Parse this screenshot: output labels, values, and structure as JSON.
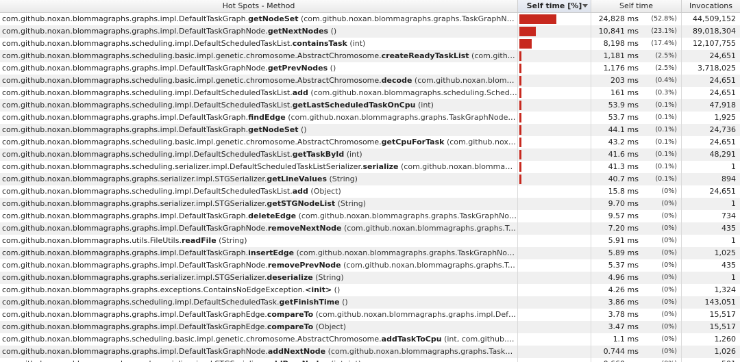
{
  "header": {
    "method": "Hot Spots - Method",
    "self_time_pct": "Self time [%]",
    "self_time": "Self time",
    "invocations": "Invocations"
  },
  "colors": {
    "bar": "#c7281e",
    "row_alt": "#f0f0f0"
  },
  "rows": [
    {
      "prefix": "com.github.noxan.blommagraphs.graphs.impl.DefaultTaskGraph.",
      "name": "getNodeSet",
      "args": " (com.github.noxan.blommagraphs.graphs.TaskGraphNode)",
      "time": "24,828 ms",
      "pct": "(52.8%)",
      "pct_value": 52.8,
      "invocations": "44,509,152"
    },
    {
      "prefix": "com.github.noxan.blommagraphs.graphs.impl.DefaultTaskGraphNode.",
      "name": "getNextNodes",
      "args": " ()",
      "time": "10,841 ms",
      "pct": "(23.1%)",
      "pct_value": 23.1,
      "invocations": "89,018,304"
    },
    {
      "prefix": "com.github.noxan.blommagraphs.scheduling.impl.DefaultScheduledTaskList.",
      "name": "containsTask",
      "args": " (int)",
      "time": "8,198 ms",
      "pct": "(17.4%)",
      "pct_value": 17.4,
      "invocations": "12,107,755"
    },
    {
      "prefix": "com.github.noxan.blommagraphs.scheduling.basic.impl.genetic.chromosome.AbstractChromosome.",
      "name": "createReadyTaskList",
      "args": " (com.github.noxan.blommagraphs.graphs.TaskGraph)",
      "time": "1,181 ms",
      "pct": "(2.5%)",
      "pct_value": 2.5,
      "invocations": "24,651"
    },
    {
      "prefix": "com.github.noxan.blommagraphs.graphs.impl.DefaultTaskGraphNode.",
      "name": "getPrevNodes",
      "args": " ()",
      "time": "1,176 ms",
      "pct": "(2.5%)",
      "pct_value": 2.5,
      "invocations": "3,718,025"
    },
    {
      "prefix": "com.github.noxan.blommagraphs.scheduling.basic.impl.genetic.chromosome.AbstractChromosome.",
      "name": "decode",
      "args": " (com.github.noxan.blommagraphs.graphs.TaskGraph)",
      "time": "203 ms",
      "pct": "(0.4%)",
      "pct_value": 0.4,
      "invocations": "24,651"
    },
    {
      "prefix": "com.github.noxan.blommagraphs.scheduling.impl.DefaultScheduledTaskList.",
      "name": "add",
      "args": " (com.github.noxan.blommagraphs.scheduling.ScheduledTask)",
      "time": "161 ms",
      "pct": "(0.3%)",
      "pct_value": 0.3,
      "invocations": "24,651"
    },
    {
      "prefix": "com.github.noxan.blommagraphs.scheduling.impl.DefaultScheduledTaskList.",
      "name": "getLastScheduledTaskOnCpu",
      "args": " (int)",
      "time": "53.9 ms",
      "pct": "(0.1%)",
      "pct_value": 0.1,
      "invocations": "47,918"
    },
    {
      "prefix": "com.github.noxan.blommagraphs.graphs.impl.DefaultTaskGraph.",
      "name": "findEdge",
      "args": " (com.github.noxan.blommagraphs.graphs.TaskGraphNode, com.github.noxan.blommagraphs.graphs.TaskGraphNode)",
      "time": "53.7 ms",
      "pct": "(0.1%)",
      "pct_value": 0.1,
      "invocations": "1,925"
    },
    {
      "prefix": "com.github.noxan.blommagraphs.graphs.impl.DefaultTaskGraph.",
      "name": "getNodeSet",
      "args": " ()",
      "time": "44.1 ms",
      "pct": "(0.1%)",
      "pct_value": 0.1,
      "invocations": "24,736"
    },
    {
      "prefix": "com.github.noxan.blommagraphs.scheduling.basic.impl.genetic.chromosome.AbstractChromosome.",
      "name": "getCpuForTask",
      "args": " (com.github.noxan.blommagraphs.graphs.TaskGraphNode)",
      "time": "43.2 ms",
      "pct": "(0.1%)",
      "pct_value": 0.1,
      "invocations": "24,651"
    },
    {
      "prefix": "com.github.noxan.blommagraphs.scheduling.impl.DefaultScheduledTaskList.",
      "name": "getTaskById",
      "args": " (int)",
      "time": "41.6 ms",
      "pct": "(0.1%)",
      "pct_value": 0.1,
      "invocations": "48,291"
    },
    {
      "prefix": "com.github.noxan.blommagraphs.scheduling.serializer.impl.DefaultScheduledTaskListSerializer.",
      "name": "serialize",
      "args": " (com.github.noxan.blommagraphs.scheduling.ScheduledTaskList)",
      "time": "41.3 ms",
      "pct": "(0.1%)",
      "pct_value": 0.1,
      "invocations": "1"
    },
    {
      "prefix": "com.github.noxan.blommagraphs.graphs.serializer.impl.STGSerializer.",
      "name": "getLineValues",
      "args": " (String)",
      "time": "40.7 ms",
      "pct": "(0.1%)",
      "pct_value": 0.1,
      "invocations": "894"
    },
    {
      "prefix": "com.github.noxan.blommagraphs.scheduling.impl.DefaultScheduledTaskList.",
      "name": "add",
      "args": " (Object)",
      "time": "15.8 ms",
      "pct": "(0%)",
      "pct_value": 0,
      "invocations": "24,651"
    },
    {
      "prefix": "com.github.noxan.blommagraphs.graphs.serializer.impl.STGSerializer.",
      "name": "getSTGNodeList",
      "args": " (String)",
      "time": "9.70 ms",
      "pct": "(0%)",
      "pct_value": 0,
      "invocations": "1"
    },
    {
      "prefix": "com.github.noxan.blommagraphs.graphs.impl.DefaultTaskGraph.",
      "name": "deleteEdge",
      "args": " (com.github.noxan.blommagraphs.graphs.TaskGraphNode, com.github.noxan.blommagraphs.graphs.TaskGraphNode)",
      "time": "9.57 ms",
      "pct": "(0%)",
      "pct_value": 0,
      "invocations": "734"
    },
    {
      "prefix": "com.github.noxan.blommagraphs.graphs.impl.DefaultTaskGraphNode.",
      "name": "removeNextNode",
      "args": " (com.github.noxan.blommagraphs.graphs.TaskGraphNode)",
      "time": "7.20 ms",
      "pct": "(0%)",
      "pct_value": 0,
      "invocations": "435"
    },
    {
      "prefix": "com.github.noxan.blommagraphs.utils.FileUtils.",
      "name": "readFile",
      "args": " (String)",
      "time": "5.91 ms",
      "pct": "(0%)",
      "pct_value": 0,
      "invocations": "1"
    },
    {
      "prefix": "com.github.noxan.blommagraphs.graphs.impl.DefaultTaskGraph.",
      "name": "insertEdge",
      "args": " (com.github.noxan.blommagraphs.graphs.TaskGraphNode, com.github.noxan.blommagraphs.graphs.TaskGraphNode)",
      "time": "5.89 ms",
      "pct": "(0%)",
      "pct_value": 0,
      "invocations": "1,025"
    },
    {
      "prefix": "com.github.noxan.blommagraphs.graphs.impl.DefaultTaskGraphNode.",
      "name": "removePrevNode",
      "args": " (com.github.noxan.blommagraphs.graphs.TaskGraphNode)",
      "time": "5.37 ms",
      "pct": "(0%)",
      "pct_value": 0,
      "invocations": "435"
    },
    {
      "prefix": "com.github.noxan.blommagraphs.graphs.serializer.impl.STGSerializer.",
      "name": "deserialize",
      "args": " (String)",
      "time": "4.96 ms",
      "pct": "(0%)",
      "pct_value": 0,
      "invocations": "1"
    },
    {
      "prefix": "com.github.noxan.blommagraphs.graphs.exceptions.ContainsNoEdgeException.",
      "name": "<init>",
      "args": " ()",
      "time": "4.26 ms",
      "pct": "(0%)",
      "pct_value": 0,
      "invocations": "1,324"
    },
    {
      "prefix": "com.github.noxan.blommagraphs.scheduling.impl.DefaultScheduledTask.",
      "name": "getFinishTime",
      "args": " ()",
      "time": "3.86 ms",
      "pct": "(0%)",
      "pct_value": 0,
      "invocations": "143,051"
    },
    {
      "prefix": "com.github.noxan.blommagraphs.graphs.impl.DefaultTaskGraphEdge.",
      "name": "compareTo",
      "args": " (com.github.noxan.blommagraphs.graphs.impl.DefaultTaskGraphEdge)",
      "time": "3.78 ms",
      "pct": "(0%)",
      "pct_value": 0,
      "invocations": "15,517"
    },
    {
      "prefix": "com.github.noxan.blommagraphs.graphs.impl.DefaultTaskGraphEdge.",
      "name": "compareTo",
      "args": " (Object)",
      "time": "3.47 ms",
      "pct": "(0%)",
      "pct_value": 0,
      "invocations": "15,517"
    },
    {
      "prefix": "com.github.noxan.blommagraphs.scheduling.basic.impl.genetic.chromosome.AbstractChromosome.",
      "name": "addTaskToCpu",
      "args": " (int, com.github.noxan.blommagraphs.graphs.TaskGraphNode)",
      "time": "1.1 ms",
      "pct": "(0%)",
      "pct_value": 0,
      "invocations": "1,260"
    },
    {
      "prefix": "com.github.noxan.blommagraphs.graphs.impl.DefaultTaskGraphNode.",
      "name": "addNextNode",
      "args": " (com.github.noxan.blommagraphs.graphs.TaskGraphNode)",
      "time": "0.744 ms",
      "pct": "(0%)",
      "pct_value": 0,
      "invocations": "1,026"
    },
    {
      "prefix": "com.github.noxan.blommagraphs.graphs.serializer.impl.STGSerializer.",
      "name": "addPrevNodes",
      "args": " (int, int)",
      "time": "0.660 ms",
      "pct": "(0%)",
      "pct_value": 0,
      "invocations": "501"
    }
  ]
}
